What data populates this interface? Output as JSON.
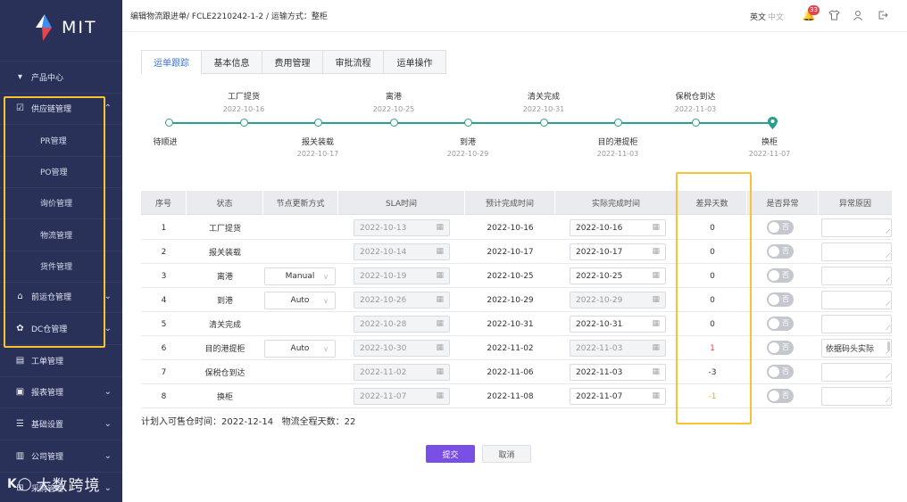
{
  "brand": {
    "name": "MIT",
    "colors": {
      "sidebar": "#2a3159",
      "accent": "#7a4fe6",
      "teal": "#2a9f8a",
      "highlight": "#f7c334"
    }
  },
  "sidebar": {
    "items": [
      {
        "label": "产品中心",
        "icon": "cube-icon",
        "expandable": false
      },
      {
        "label": "供应链管理",
        "icon": "clipboard-icon",
        "expandable": true,
        "expanded": true
      },
      {
        "label": "前运仓管理",
        "icon": "home-icon",
        "expandable": true
      },
      {
        "label": "DC仓管理",
        "icon": "cluster-icon",
        "expandable": true
      },
      {
        "label": "工单管理",
        "icon": "doc-icon",
        "expandable": false
      },
      {
        "label": "报表管理",
        "icon": "chart-icon",
        "expandable": true
      },
      {
        "label": "基础设置",
        "icon": "sliders-icon",
        "expandable": true
      },
      {
        "label": "公司管理",
        "icon": "building-icon",
        "expandable": true
      },
      {
        "label": "采购管理",
        "icon": "cart-icon",
        "expandable": true
      }
    ],
    "subitems": [
      "PR管理",
      "PO管理",
      "询价管理",
      "物流管理",
      "货件管理"
    ],
    "watermark": "大数跨境"
  },
  "header": {
    "breadcrumb": "编辑物流跟进单/ FCLE2210242-1-2 / 运输方式：整柜",
    "lang_en": "英文",
    "lang_cn": "中文",
    "notifications": "33"
  },
  "tabs": [
    "运单跟踪",
    "基本信息",
    "费用管理",
    "审批流程",
    "运单操作"
  ],
  "timeline": {
    "top": [
      {
        "label": "工厂提货",
        "date": "2022-10-16"
      },
      {
        "label": "离港",
        "date": "2022-10-25"
      },
      {
        "label": "清关完成",
        "date": "2022-10-31"
      },
      {
        "label": "保税仓到达",
        "date": "2022-11-03"
      }
    ],
    "bottom": [
      {
        "label": "待顺进",
        "date": ""
      },
      {
        "label": "报关装载",
        "date": "2022-10-17"
      },
      {
        "label": "到港",
        "date": "2022-10-29"
      },
      {
        "label": "目的港提柜",
        "date": "2022-11-03"
      },
      {
        "label": "换柜",
        "date": "2022-11-07"
      }
    ]
  },
  "table": {
    "headers": [
      "序号",
      "状态",
      "节点更新方式",
      "SLA时间",
      "预计完成时间",
      "实际完成时间",
      "差异天数",
      "是否异常",
      "异常原因"
    ],
    "rows": [
      {
        "no": "1",
        "status": "工厂提货",
        "mode": "",
        "sla": "2022-10-13",
        "est": "2022-10-16",
        "act": "2022-10-16",
        "act_enabled": true,
        "diff": "0",
        "abn": "否",
        "reason": ""
      },
      {
        "no": "2",
        "status": "报关装载",
        "mode": "",
        "sla": "2022-10-14",
        "est": "2022-10-17",
        "act": "2022-10-17",
        "act_enabled": true,
        "diff": "0",
        "abn": "否",
        "reason": ""
      },
      {
        "no": "3",
        "status": "离港",
        "mode": "Manual",
        "sla": "2022-10-19",
        "est": "2022-10-25",
        "act": "2022-10-25",
        "act_enabled": true,
        "diff": "0",
        "abn": "否",
        "reason": ""
      },
      {
        "no": "4",
        "status": "到港",
        "mode": "Auto",
        "sla": "2022-10-26",
        "est": "2022-10-29",
        "act": "2022-10-29",
        "act_enabled": false,
        "diff": "0",
        "abn": "否",
        "reason": ""
      },
      {
        "no": "5",
        "status": "清关完成",
        "mode": "",
        "sla": "2022-10-28",
        "est": "2022-10-31",
        "act": "2022-10-31",
        "act_enabled": true,
        "diff": "0",
        "abn": "否",
        "reason": ""
      },
      {
        "no": "6",
        "status": "目的港提柜",
        "mode": "Auto",
        "sla": "2022-10-30",
        "est": "2022-11-02",
        "act": "2022-11-03",
        "act_enabled": false,
        "diff": "1",
        "abn": "否",
        "reason": "依据码头实际"
      },
      {
        "no": "7",
        "status": "保税仓到达",
        "mode": "",
        "sla": "2022-11-02",
        "est": "2022-11-06",
        "act": "2022-11-03",
        "act_enabled": true,
        "diff": "-3",
        "abn": "否",
        "reason": ""
      },
      {
        "no": "8",
        "status": "换柜",
        "mode": "",
        "sla": "2022-11-07",
        "est": "2022-11-08",
        "act": "2022-11-07",
        "act_enabled": true,
        "diff": "-1",
        "abn": "否",
        "reason": ""
      }
    ]
  },
  "footer": {
    "summary": "计划入可售仓时间：2022-12-14   物流全程天数：22"
  },
  "buttons": {
    "submit": "提交",
    "cancel": "取消"
  }
}
